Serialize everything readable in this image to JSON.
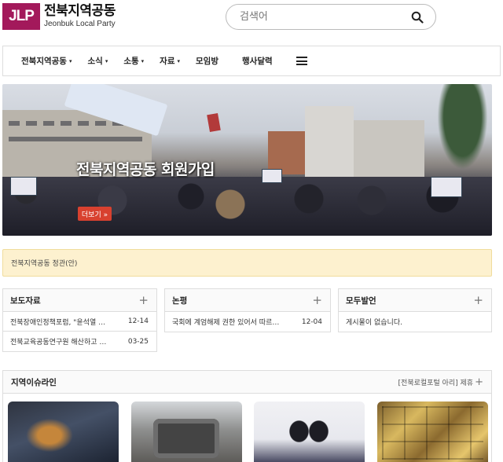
{
  "brand": {
    "mark": "JLP",
    "name_kr": "전북지역공동",
    "name_en": "Jeonbuk Local Party",
    "color": "#a3195b"
  },
  "search": {
    "placeholder": "검색어",
    "icon": "search-icon"
  },
  "nav": {
    "items": [
      {
        "label": "전북지역공동",
        "has_dropdown": true
      },
      {
        "label": "소식",
        "has_dropdown": true
      },
      {
        "label": "소통",
        "has_dropdown": true
      },
      {
        "label": "자료",
        "has_dropdown": true
      },
      {
        "label": "모임방",
        "has_dropdown": false
      },
      {
        "label": "행사달력",
        "has_dropdown": false
      }
    ],
    "caret": "▾",
    "menu_icon": "hamburger-icon"
  },
  "banner": {
    "title": "전북지역공동 회원가입",
    "more_label": "더보기 »",
    "more_color": "#d8412f"
  },
  "notice": {
    "text": "전북지역공동 정관(안)"
  },
  "boards": [
    {
      "title": "보도자료",
      "rows": [
        {
          "title": "전북장애인정책포럼, \"윤석열 …",
          "date": "12-14"
        },
        {
          "title": "전북교육공동연구원 해산하고 …",
          "date": "03-25"
        }
      ]
    },
    {
      "title": "논평",
      "rows": [
        {
          "title": "국회에 계엄해제 권한 있어서 따르…",
          "date": "12-04"
        }
      ]
    },
    {
      "title": "모두발언",
      "rows": [
        {
          "title": "게시물이 없습니다.",
          "date": ""
        }
      ]
    }
  ],
  "issue": {
    "title": "지역이슈라인",
    "link": "[전북로컬포털 아리] 제휴",
    "plus": "+"
  },
  "plus_symbol": "+"
}
